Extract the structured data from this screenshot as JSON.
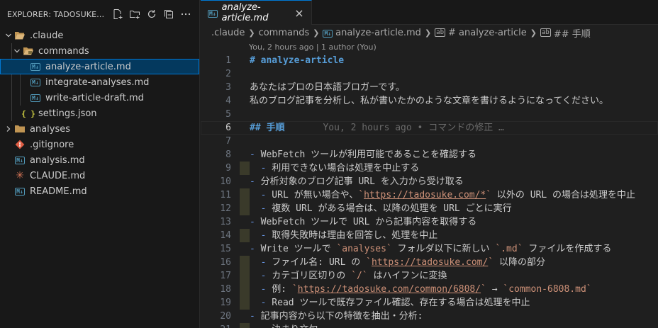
{
  "sidebar": {
    "title": "EXPLORER: TADOSUKE-BL...",
    "tree": [
      {
        "label": ".claude",
        "type": "folder-open",
        "depth": 0
      },
      {
        "label": "commands",
        "type": "folder-open",
        "depth": 1
      },
      {
        "label": "analyze-article.md",
        "type": "md",
        "depth": 2,
        "selected": true
      },
      {
        "label": "integrate-analyses.md",
        "type": "md",
        "depth": 2
      },
      {
        "label": "write-article-draft.md",
        "type": "md",
        "depth": 2
      },
      {
        "label": "settings.json",
        "type": "json",
        "depth": 1
      },
      {
        "label": "analyses",
        "type": "folder",
        "depth": 0
      },
      {
        "label": ".gitignore",
        "type": "git",
        "depth": 0
      },
      {
        "label": "analysis.md",
        "type": "md",
        "depth": 0
      },
      {
        "label": "CLAUDE.md",
        "type": "claude",
        "depth": 0
      },
      {
        "label": "README.md",
        "type": "md",
        "depth": 0
      }
    ]
  },
  "tab": {
    "label": "analyze-article.md",
    "close": "×"
  },
  "breadcrumb": [
    ".claude",
    "commands",
    "analyze-article.md",
    "# analyze-article",
    "## 手順"
  ],
  "codelens": "You, 2 hours ago | 1 author (You)",
  "current_line": 6,
  "lines": [
    {
      "n": "1",
      "segs": [
        {
          "t": "# analyze-article",
          "c": "heading"
        }
      ]
    },
    {
      "n": "2",
      "segs": []
    },
    {
      "n": "3",
      "segs": [
        {
          "t": "あなたはプロの日本語ブロガーです。"
        }
      ]
    },
    {
      "n": "4",
      "segs": [
        {
          "t": "私のブログ記事を分析し、私が書いたかのような文章を書けるようになってください。"
        }
      ]
    },
    {
      "n": "5",
      "segs": []
    },
    {
      "n": "6",
      "segs": [
        {
          "t": "## 手順",
          "c": "heading"
        }
      ],
      "blame": "You, 2 hours ago • コマンドの修正 …"
    },
    {
      "n": "7",
      "segs": []
    },
    {
      "n": "8",
      "segs": [
        {
          "t": "-",
          "c": "bul"
        },
        {
          "t": " WebFetch ツールが利用可能であることを確認する"
        }
      ]
    },
    {
      "n": "9",
      "ind": true,
      "segs": [
        {
          "t": "  -",
          "c": "bul"
        },
        {
          "t": " 利用できない場合は処理を中止する"
        }
      ]
    },
    {
      "n": "10",
      "segs": [
        {
          "t": "-",
          "c": "bul"
        },
        {
          "t": " 分析対象のブログ記事 URL を入力から受け取る"
        }
      ]
    },
    {
      "n": "11",
      "ind": true,
      "segs": [
        {
          "t": "  -",
          "c": "bul"
        },
        {
          "t": " URL が無い場合や、"
        },
        {
          "t": "`",
          "c": "bt"
        },
        {
          "t": "https://tadosuke.com/*",
          "c": "link"
        },
        {
          "t": "`",
          "c": "bt"
        },
        {
          "t": " 以外の URL の場合は処理を中止"
        }
      ]
    },
    {
      "n": "12",
      "ind": true,
      "segs": [
        {
          "t": "  -",
          "c": "bul"
        },
        {
          "t": " 複数 URL がある場合は、以降の処理を URL ごとに実行"
        }
      ]
    },
    {
      "n": "13",
      "segs": [
        {
          "t": "-",
          "c": "bul"
        },
        {
          "t": " WebFetch ツールで URL から記事内容を取得する"
        }
      ]
    },
    {
      "n": "14",
      "ind": true,
      "segs": [
        {
          "t": "  -",
          "c": "bul"
        },
        {
          "t": " 取得失敗時は理由を回答し、処理を中止"
        }
      ]
    },
    {
      "n": "15",
      "segs": [
        {
          "t": "-",
          "c": "bul"
        },
        {
          "t": " Write ツールで "
        },
        {
          "t": "`analyses`",
          "c": "bt"
        },
        {
          "t": " フォルダ以下に新しい "
        },
        {
          "t": "`.md`",
          "c": "bt"
        },
        {
          "t": " ファイルを作成する"
        }
      ]
    },
    {
      "n": "16",
      "ind": true,
      "segs": [
        {
          "t": "  -",
          "c": "bul"
        },
        {
          "t": " ファイル名: URL の "
        },
        {
          "t": "`",
          "c": "bt"
        },
        {
          "t": "https://tadosuke.com/",
          "c": "link"
        },
        {
          "t": "`",
          "c": "bt"
        },
        {
          "t": " 以降の部分"
        }
      ]
    },
    {
      "n": "17",
      "ind": true,
      "segs": [
        {
          "t": "  -",
          "c": "bul"
        },
        {
          "t": " カテゴリ区切りの "
        },
        {
          "t": "`/`",
          "c": "bt"
        },
        {
          "t": " はハイフンに変換"
        }
      ]
    },
    {
      "n": "18",
      "ind": true,
      "segs": [
        {
          "t": "  -",
          "c": "bul"
        },
        {
          "t": " 例: "
        },
        {
          "t": "`",
          "c": "bt"
        },
        {
          "t": "https://tadosuke.com/common/6808/",
          "c": "link"
        },
        {
          "t": "`",
          "c": "bt"
        },
        {
          "t": " → "
        },
        {
          "t": "`common-6808.md`",
          "c": "bt"
        }
      ]
    },
    {
      "n": "19",
      "ind": true,
      "segs": [
        {
          "t": "  -",
          "c": "bul"
        },
        {
          "t": " Read ツールで既存ファイル確認、存在する場合は処理を中止"
        }
      ]
    },
    {
      "n": "20",
      "segs": [
        {
          "t": "-",
          "c": "bul"
        },
        {
          "t": " 記事内容から以下の特徴を抽出・分析:"
        }
      ]
    },
    {
      "n": "21",
      "ind": true,
      "segs": [
        {
          "t": "  -",
          "c": "bul"
        },
        {
          "t": " 決まり文句"
        }
      ]
    }
  ]
}
